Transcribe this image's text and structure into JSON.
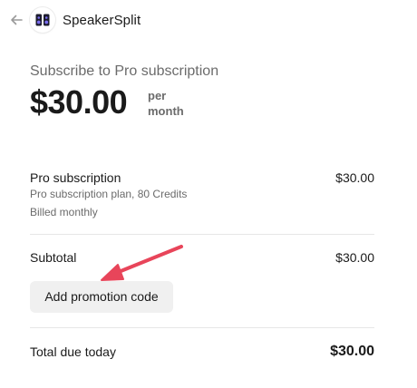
{
  "header": {
    "brand_name": "SpeakerSplit"
  },
  "summary": {
    "subscribe_title": "Subscribe to Pro subscription",
    "price": "$30.00",
    "period_line1": "per",
    "period_line2": "month"
  },
  "line_item": {
    "name": "Pro subscription",
    "price": "$30.00",
    "description": "Pro subscription plan, 80 Credits",
    "billing": "Billed monthly"
  },
  "subtotal": {
    "label": "Subtotal",
    "value": "$30.00"
  },
  "promo": {
    "button_label": "Add promotion code"
  },
  "total": {
    "label": "Total due today",
    "value": "$30.00"
  },
  "colors": {
    "annotation_arrow": "#e8455a",
    "muted_text": "#6b6b6b",
    "button_bg": "#f0f0f0",
    "logo_accent": "#5b4ad6"
  }
}
